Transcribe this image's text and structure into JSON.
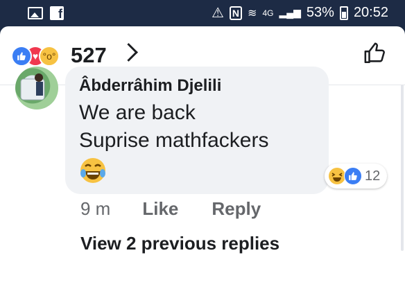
{
  "status_bar": {
    "network": "4G",
    "battery": "53%",
    "time": "20:52"
  },
  "reactions_header": {
    "count": "527",
    "icons": [
      "like-icon",
      "love-icon",
      "wow-icon"
    ]
  },
  "comment": {
    "author": "Âbderrâhim Djelili",
    "line1": "We are back",
    "line2": "Suprise mathfackers",
    "emoji": "laughing-emoji",
    "reaction_count": "12",
    "reaction_icons": [
      "haha-icon",
      "like-icon"
    ],
    "time": "9 m",
    "like_label": "Like",
    "reply_label": "Reply"
  },
  "view_previous": "View 2 previous replies",
  "colors": {
    "status_bg": "#1d2b45",
    "like_blue": "#3b7ef4",
    "love_red": "#f0384f",
    "emoji_yellow": "#f7c242",
    "bubble_bg": "#f0f2f5",
    "secondary_text": "#65676b"
  }
}
